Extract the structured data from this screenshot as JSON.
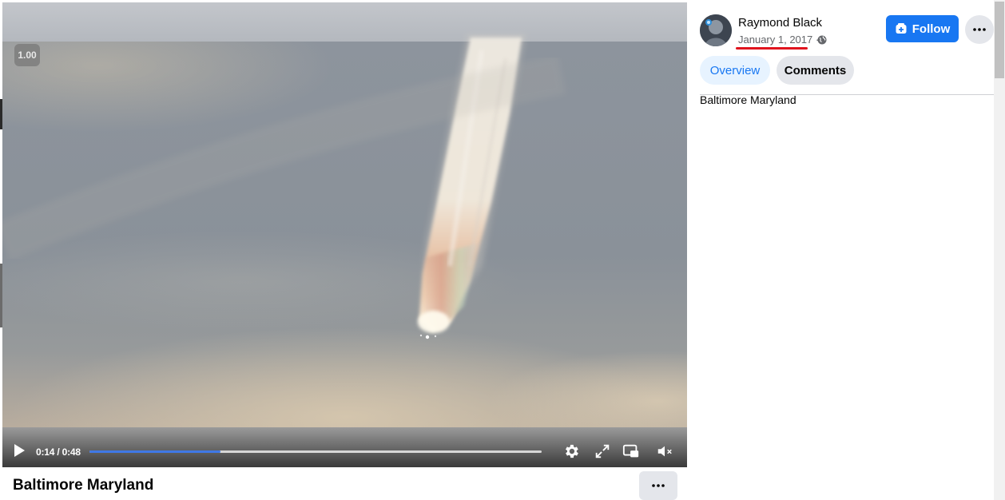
{
  "video": {
    "speed_badge": "1.00",
    "time_display": "0:14 / 0:48",
    "progress": 0.29,
    "accent_color": "#3f78e6"
  },
  "post": {
    "title": "Baltimore Maryland",
    "description": "Baltimore Maryland"
  },
  "author": {
    "name": "Raymond Black",
    "date": "January 1, 2017",
    "date_separator": "·",
    "follow_label": "Follow"
  },
  "tabs": [
    {
      "label": "Overview",
      "active": true
    },
    {
      "label": "Comments",
      "active": false
    }
  ],
  "icons": {
    "play": "play-icon",
    "settings": "gear-icon",
    "fullscreen": "expand-icon",
    "miniplayer": "picture-in-picture-icon",
    "volume": "volume-muted-icon",
    "more": "ellipsis-icon",
    "follow": "follow-plus-icon",
    "privacy": "globe-icon"
  },
  "colors": {
    "brand_blue": "#1877f2",
    "date_underline": "#e0141e"
  }
}
